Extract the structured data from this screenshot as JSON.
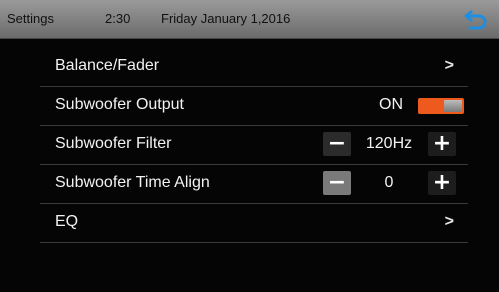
{
  "status": {
    "title": "Settings",
    "time": "2:30",
    "date": "Friday January 1,2016"
  },
  "rows": [
    {
      "label": "Balance/Fader",
      "action": ">"
    },
    {
      "label": "Subwoofer Output",
      "state": "ON"
    },
    {
      "label": "Subwoofer Filter",
      "minus": "−",
      "value": "120Hz",
      "plus": "+"
    },
    {
      "label": "Subwoofer Time Align",
      "minus": "−",
      "value": "0",
      "plus": "+"
    },
    {
      "label": "EQ",
      "action": ">"
    }
  ],
  "colors": {
    "toggle_on": "#ee5a1e",
    "back_icon": "#1e8fe0"
  },
  "icons": {
    "back": "back-arrow-icon"
  }
}
